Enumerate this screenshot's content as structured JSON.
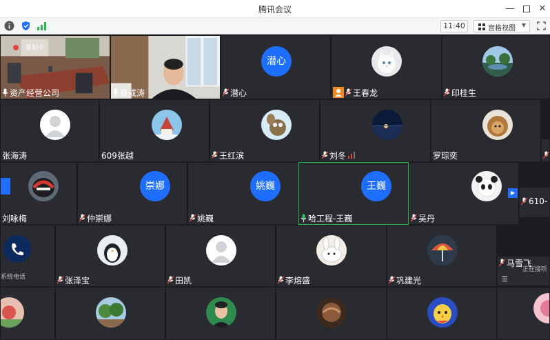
{
  "window": {
    "title": "腾讯会议"
  },
  "toolbar": {
    "time": "11:40",
    "view_mode": "宫格视图",
    "rec_label": "录制中"
  },
  "participants": {
    "p1": "资产经营公司",
    "p2": "蔡成涛",
    "p3": "潜心",
    "p3_avatar": "潜心",
    "p4": "王春龙",
    "p5": "印桂生",
    "p6": "张海涛",
    "p7": "609张越",
    "p8": "王红滨",
    "p9": "刘冬",
    "p10": "罗琮奕",
    "p11": "刘咏梅",
    "p12": "仲崇娜",
    "p12_avatar": "崇娜",
    "p13": "姚巍",
    "p13_avatar": "姚巍",
    "p14": "哈工程-王巍",
    "p14_avatar": "王巍",
    "p15": "吴丹",
    "p16": "610-",
    "p17": "张泽宝",
    "p18": "田凯",
    "p19": "李熔盛",
    "p20": "巩建光",
    "p21": "马雪飞",
    "phone_label": "系统电话",
    "phone_extra": "正在接听"
  },
  "colors": {
    "grid_bg": "#1c1d21",
    "tile_bg": "#2a2b30",
    "avatar_blue": "#1e6fff",
    "active_border": "#2fb34a",
    "muted_red": "#e2473d",
    "mic_green": "#39c267"
  }
}
